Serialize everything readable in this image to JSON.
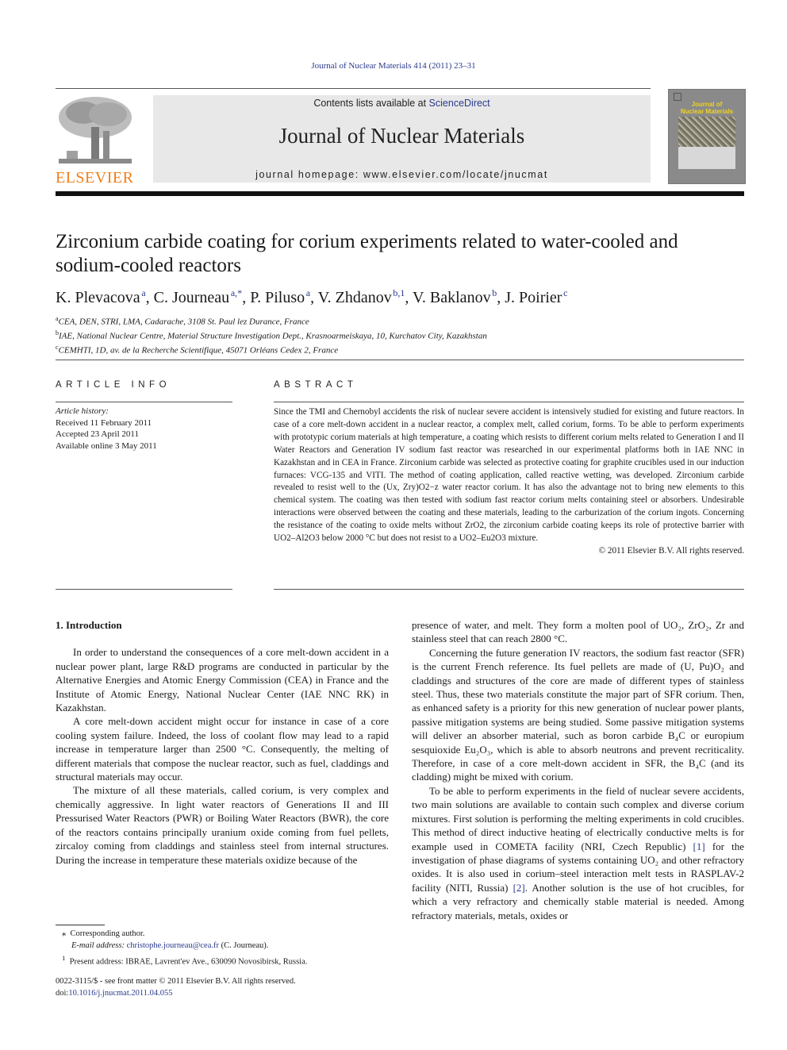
{
  "running_head": "Journal of Nuclear Materials 414 (2011) 23–31",
  "header": {
    "publisher_wordmark": "ELSEVIER",
    "contents_prefix": "Contents lists available at ",
    "contents_link": "ScienceDirect",
    "journal_title": "Journal of Nuclear Materials",
    "homepage_prefix": "journal homepage: ",
    "homepage_url": "www.elsevier.com/locate/jnucmat",
    "cover_title_line1": "Journal of",
    "cover_title_line2": "Nuclear Materials"
  },
  "article": {
    "title": "Zirconium carbide coating for corium experiments related to water-cooled and sodium-cooled reactors",
    "authors": [
      {
        "name": "K. Plevacova",
        "sup": "a"
      },
      {
        "name": "C. Journeau",
        "sup": "a,*"
      },
      {
        "name": "P. Piluso",
        "sup": "a"
      },
      {
        "name": "V. Zhdanov",
        "sup": "b,1"
      },
      {
        "name": "V. Baklanov",
        "sup": "b"
      },
      {
        "name": "J. Poirier",
        "sup": "c"
      }
    ],
    "affiliations": [
      {
        "sup": "a",
        "text": "CEA, DEN, STRI, LMA, Cadarache, 3108 St. Paul lez Durance, France"
      },
      {
        "sup": "b",
        "text": "IAE, National Nuclear Centre, Material Structure Investigation Dept., Krasnoarmeiskaya, 10, Kurchatov City, Kazakhstan"
      },
      {
        "sup": "c",
        "text": "CEMHTI, 1D, av. de la Recherche Scientifique, 45071 Orléans Cedex 2, France"
      }
    ]
  },
  "article_info": {
    "heading": "ARTICLE INFO",
    "history_label": "Article history:",
    "received": "Received 11 February 2011",
    "accepted": "Accepted 23 April 2011",
    "online": "Available online 3 May 2011"
  },
  "abstract": {
    "heading": "ABSTRACT",
    "p1": "Since the TMI and Chernobyl accidents the risk of nuclear severe accident is intensively studied for existing and future reactors. In case of a core melt-down accident in a nuclear reactor, a complex melt, called corium, forms. To be able to perform experiments with prototypic corium materials at high temperature, a coating which resists to different corium melts related to Generation I and II Water Reactors and Generation IV sodium fast reactor was researched in our experimental platforms both in IAE NNC in Kazakhstan and in CEA in France. Zirconium carbide was selected as protective coating for graphite crucibles used in our induction furnaces: VCG-135 and VITI. The method of coating application, called reactive wetting, was developed. Zirconium carbide revealed to resist well to the (Ux, Zry)O2−z water reactor corium. It has also the advantage not to bring new elements to this chemical system. The coating was then tested with sodium fast reactor corium melts containing steel or absorbers. Undesirable interactions were observed between the coating and these materials, leading to the carburization of the corium ingots. Concerning the resistance of the coating to oxide melts without ZrO2, the zirconium carbide coating keeps its role of protective barrier with UO2–Al2O3 below 2000 °C but does not resist to a UO2–Eu2O3 mixture.",
    "copyright": "© 2011 Elsevier B.V. All rights reserved."
  },
  "body": {
    "section_heading": "1. Introduction",
    "left_paragraphs": [
      "In order to understand the consequences of a core melt-down accident in a nuclear power plant, large R&D programs are conducted in particular by the Alternative Energies and Atomic Energy Commission (CEA) in France and the Institute of Atomic Energy, National Nuclear Center (IAE NNC RK) in Kazakhstan.",
      "A core melt-down accident might occur for instance in case of a core cooling system failure. Indeed, the loss of coolant flow may lead to a rapid increase in temperature larger than 2500 °C. Consequently, the melting of different materials that compose the nuclear reactor, such as fuel, claddings and structural materials may occur.",
      "The mixture of all these materials, called corium, is very complex and chemically aggressive. In light water reactors of Generations II and III Pressurised Water Reactors (PWR) or Boiling Water Reactors (BWR), the core of the reactors contains principally uranium oxide coming from fuel pellets, zircaloy coming from claddings and stainless steel from internal structures. During the increase in temperature these materials oxidize because of the"
    ],
    "right_p0": "presence of water, and melt. They form a molten pool of UO₂, ZrO₂, Zr and stainless steel that can reach 2800 °C.",
    "right_p1": "Concerning the future generation IV reactors, the sodium fast reactor (SFR) is the current French reference. Its fuel pellets are made of (U, Pu)O₂ and claddings and structures of the core are made of different types of stainless steel. Thus, these two materials constitute the major part of SFR corium. Then, as enhanced safety is a priority for this new generation of nuclear power plants, passive mitigation systems are being studied. Some passive mitigation systems will deliver an absorber material, such as boron carbide B₄C or europium sesquioxide Eu₂O₃, which is able to absorb neutrons and prevent recriticality. Therefore, in case of a core melt-down accident in SFR, the B₄C (and its cladding) might be mixed with corium.",
    "right_p2_a": "To be able to perform experiments in the field of nuclear severe accidents, two main solutions are available to contain such complex and diverse corium mixtures. First solution is performing the melting experiments in cold crucibles. This method of direct inductive heating of electrically conductive melts is for example used in COMETA facility (NRI, Czech Republic) ",
    "ref1": "[1]",
    "right_p2_b": " for the investigation of phase diagrams of systems containing UO₂ and other refractory oxides. It is also used in corium–steel interaction melt tests in RASPLAV-2 facility (NITI, Russia) ",
    "ref2": "[2]",
    "right_p2_c": ". Another solution is the use of hot crucibles, for which a very refractory and chemically stable material is needed. Among refractory materials, metals, oxides or"
  },
  "footnotes": {
    "star_mark": "⁎",
    "corresponding": "Corresponding author.",
    "email_label": "E-mail address: ",
    "email": "christophe.journeau@cea.fr",
    "email_suffix": " (C. Journeau).",
    "one_mark": "1",
    "present_address": "Present address: IBRAE, Lavrent'ev Ave., 630090 Novosibirsk, Russia."
  },
  "front_matter": {
    "issn_line": "0022-3115/$ - see front matter © 2011 Elsevier B.V. All rights reserved.",
    "doi_prefix": "doi:",
    "doi": "10.1016/j.jnucmat.2011.04.055"
  },
  "colors": {
    "link": "#2a3a8c",
    "elsevier_orange": "#f07f1a",
    "banner_gray": "#e8e8e8",
    "cover_yellow": "#f1d21c"
  }
}
